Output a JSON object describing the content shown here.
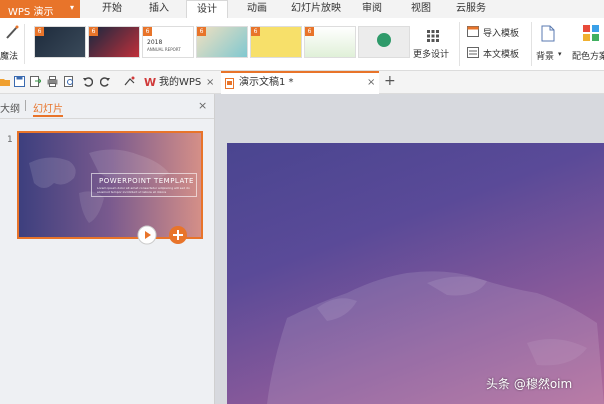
{
  "app": {
    "name": "WPS 演示",
    "caret": "▾"
  },
  "menu": {
    "items": [
      "开始",
      "插入",
      "设计",
      "动画",
      "幻灯片放映",
      "审阅",
      "视图",
      "云服务"
    ],
    "active": "设计"
  },
  "ribbon": {
    "magic_label": "魔法",
    "more_design_label": "更多设计",
    "import_template_label": "导入模板",
    "this_template_label": "本文模板",
    "background_label": "背景",
    "color_scheme_label": "配色方案",
    "thumbnail_texts": [
      "2018",
      "ANNUAL REPORT"
    ]
  },
  "tabs": {
    "wps_label": "我的WPS",
    "doc_label": "演示文稿1 *",
    "close_symbol": "×",
    "add_symbol": "+"
  },
  "panel": {
    "outline_label": "大纲",
    "slides_label": "幻灯片",
    "close_symbol": "×",
    "slide_number": "1"
  },
  "thumbnail": {
    "title": "POWERPOINT TEMPLATE",
    "subtitle_line1": "Lorem ipsum dolor sit amet consectetur adipiscing elit sed do",
    "subtitle_line2": "eiusmod tempor incididunt ut labore et dolore"
  },
  "watermark": {
    "text": "头条 @穆然oim"
  },
  "colors": {
    "accent": "#e8742a",
    "slide_top": "#4a4590",
    "slide_bottom": "#b06a9a"
  }
}
